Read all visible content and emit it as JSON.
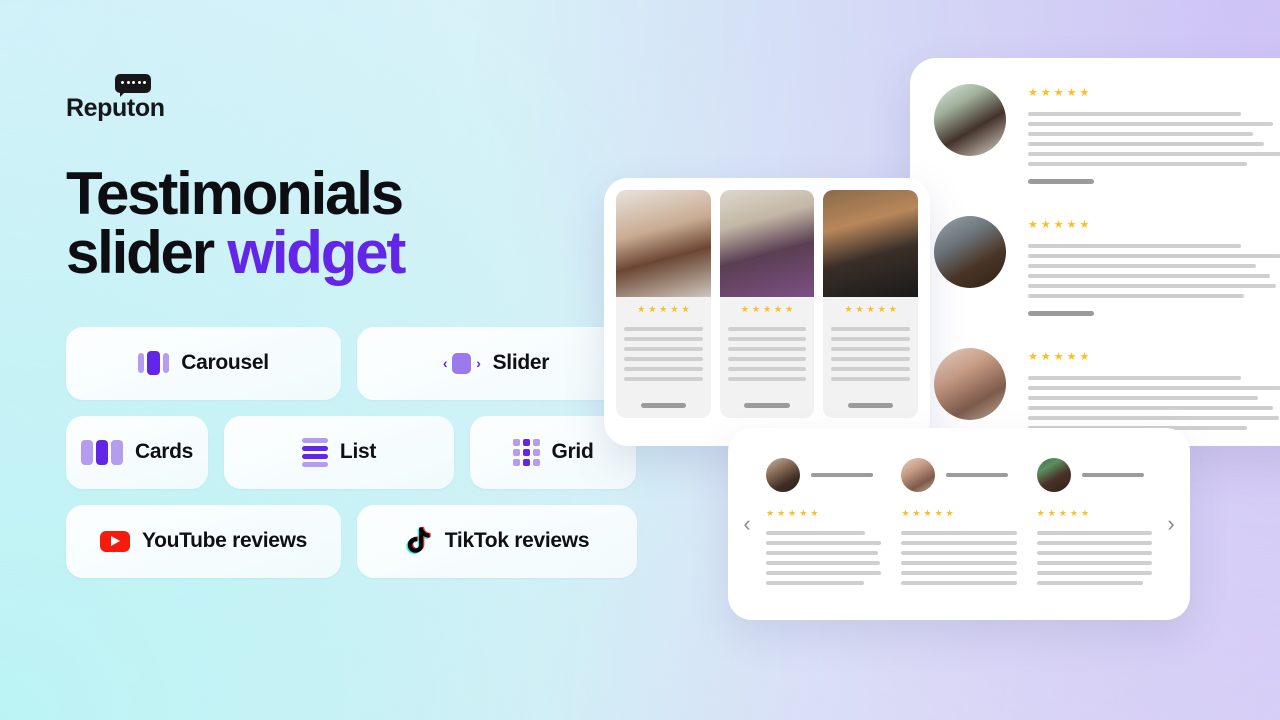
{
  "brand": {
    "name": "Reputon",
    "icon": "speech-bubble-icon",
    "dot_count": 5
  },
  "headline": {
    "line1": "Testimonials",
    "line2_plain": "slider ",
    "line2_accent": "widget"
  },
  "colors": {
    "accent_purple": "#6325e8",
    "icon_light_purple": "#b49df0",
    "star_gold": "#fbbf24",
    "youtube_red": "#f61c0d",
    "tiktok_black": "#010101",
    "tiktok_cyan": "#25f4ee",
    "tiktok_pink": "#fe2c55"
  },
  "pills": {
    "row1": [
      {
        "label": "Carousel",
        "icon": "carousel-icon"
      },
      {
        "label": "Slider",
        "icon": "slider-icon"
      }
    ],
    "row2": [
      {
        "label": "Cards",
        "icon": "cards-icon"
      },
      {
        "label": "List",
        "icon": "list-icon"
      },
      {
        "label": "Grid",
        "icon": "grid-icon"
      }
    ],
    "row3": [
      {
        "label": "YouTube reviews",
        "icon": "youtube-icon"
      },
      {
        "label": "TikTok reviews",
        "icon": "tiktok-icon"
      }
    ]
  },
  "widgets": {
    "list_widget": {
      "name": "list-layout-preview",
      "rows": [
        {
          "avatar": "woman-palm-trees-avatar",
          "rating": 5,
          "text_lines": 6,
          "has_name_bar": true
        },
        {
          "avatar": "man-grey-background-avatar",
          "rating": 5,
          "text_lines": 6,
          "has_name_bar": true
        },
        {
          "avatar": "woman-striped-shirt-avatar",
          "rating": 5,
          "text_lines": 6,
          "has_name_bar": true
        }
      ]
    },
    "cards_widget": {
      "name": "cards-layout-preview",
      "cards": [
        {
          "photo": "woman-curly-hair-photo",
          "rating": 5,
          "text_lines": 6,
          "has_name_bar": true
        },
        {
          "photo": "man-purple-sweater-photo",
          "rating": 5,
          "text_lines": 6,
          "has_name_bar": true
        },
        {
          "photo": "bearded-man-cap-photo",
          "rating": 5,
          "text_lines": 6,
          "has_name_bar": true
        }
      ]
    },
    "carousel_widget": {
      "name": "carousel-layout-preview",
      "prev_label": "‹",
      "next_label": "›",
      "columns": [
        {
          "avatar": "bearded-man-avatar",
          "rating": 5,
          "text_lines": 6,
          "has_name_bar": true
        },
        {
          "avatar": "young-woman-avatar",
          "rating": 5,
          "text_lines": 6,
          "has_name_bar": true
        },
        {
          "avatar": "smiling-man-avatar",
          "rating": 5,
          "text_lines": 6,
          "has_name_bar": true
        }
      ]
    },
    "star_glyph": "★"
  }
}
